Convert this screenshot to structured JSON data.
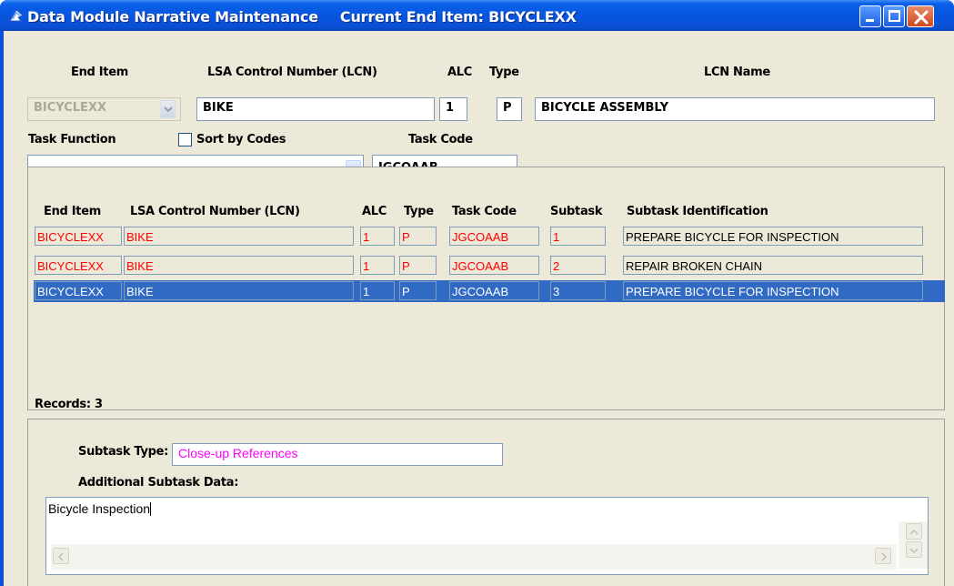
{
  "window": {
    "title": "Data Module Narrative Maintenance",
    "subtitle": "Current End Item: BICYCLEXX"
  },
  "header": {
    "end_item_label": "End Item",
    "lcn_label": "LSA Control Number (LCN)",
    "alc_label": "ALC",
    "type_label": "Type",
    "lcn_name_label": "LCN Name",
    "end_item_value": "BICYCLEXX",
    "lcn_value": "BIKE",
    "alc_value": "1",
    "type_value": "P",
    "lcn_name_value": "BICYCLE ASSEMBLY",
    "task_function_label": "Task Function",
    "task_function_value": "",
    "sort_by_codes_label": "Sort by Codes",
    "sort_by_codes_checked": false,
    "task_code_label": "Task Code",
    "task_code_value": "JGCOAAB"
  },
  "grid": {
    "columns": [
      "End Item",
      "LSA Control Number (LCN)",
      "ALC",
      "Type",
      "Task Code",
      "Subtask",
      "Subtask Identification"
    ],
    "rows": [
      {
        "end_item": "BICYCLEXX",
        "lcn": "BIKE",
        "alc": "1",
        "type": "P",
        "task_code": "JGCOAAB",
        "subtask": "1",
        "identification": "PREPARE BICYCLE FOR INSPECTION",
        "style": "red"
      },
      {
        "end_item": "BICYCLEXX",
        "lcn": "BIKE",
        "alc": "1",
        "type": "P",
        "task_code": "JGCOAAB",
        "subtask": "2",
        "identification": "REPAIR BROKEN CHAIN",
        "style": "red"
      },
      {
        "end_item": "BICYCLEXX",
        "lcn": "BIKE",
        "alc": "1",
        "type": "P",
        "task_code": "JGCOAAB",
        "subtask": "3",
        "identification": "PREPARE BICYCLE FOR INSPECTION",
        "style": "selected"
      }
    ],
    "records_label": "Records: 3"
  },
  "detail": {
    "subtask_type_label": "Subtask Type:",
    "subtask_type_value": "Close-up References",
    "additional_label": "Additional Subtask Data:",
    "additional_value": "Bicycle Inspection"
  },
  "colors": {
    "title_bar": "#0856e0",
    "selection": "#316ac5",
    "highlight_text": "#ff0000",
    "subtask_type_text": "#ff00ff"
  },
  "icons": {
    "app": "app-icon",
    "minimize": "minimize-icon",
    "maximize": "maximize-icon",
    "close": "close-icon",
    "dropdown": "chevron-down-icon"
  }
}
